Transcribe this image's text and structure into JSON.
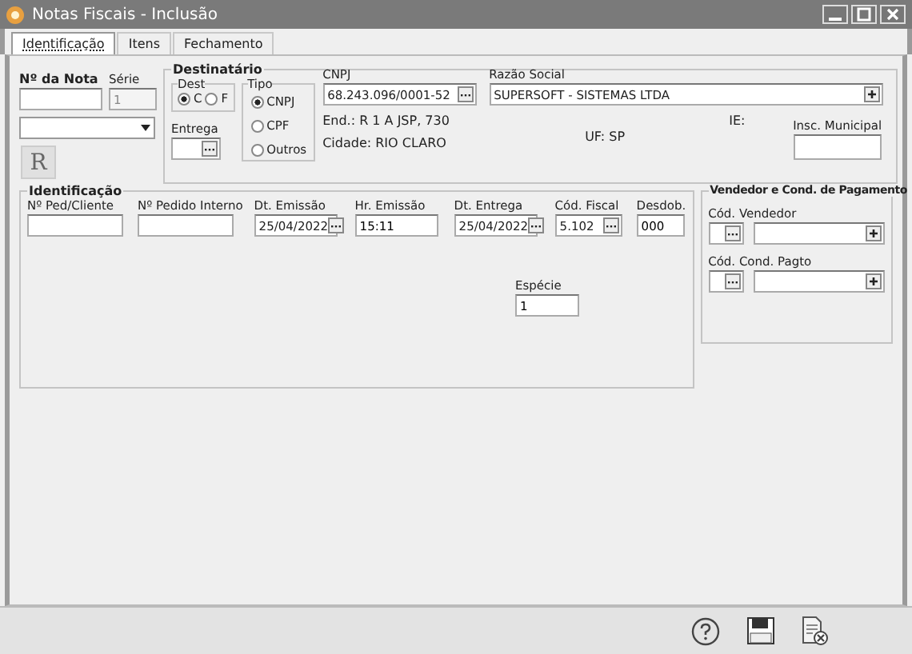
{
  "window": {
    "title": "Notas Fiscais - Inclusão"
  },
  "tabs": [
    {
      "label": "Identificação",
      "selected": true
    },
    {
      "label": "Itens",
      "selected": false
    },
    {
      "label": "Fechamento",
      "selected": false
    }
  ],
  "nota": {
    "label": "Nº da Nota",
    "serie_label": "Série",
    "serie_value": "1",
    "r_button": "R"
  },
  "destinatario": {
    "title": "Destinatário",
    "dest": {
      "title": "Dest",
      "options": [
        {
          "label": "C",
          "selected": true
        },
        {
          "label": "F",
          "selected": false
        }
      ]
    },
    "entrega_label": "Entrega",
    "tipo": {
      "title": "Tipo",
      "options": [
        {
          "label": "CNPJ",
          "selected": true
        },
        {
          "label": "CPF",
          "selected": false
        },
        {
          "label": "Outros",
          "selected": false
        }
      ]
    },
    "cnpj": {
      "label": "CNPJ",
      "value": "68.243.096/0001-52"
    },
    "endereco": "End.: R 1 A JSP, 730",
    "cidade": "Cidade: RIO CLARO",
    "razao": {
      "label": "Razão Social",
      "value": "SUPERSOFT - SISTEMAS LTDA"
    },
    "ie": "IE:",
    "uf": "UF: SP",
    "insc_label": "Insc. Municipal"
  },
  "identificacao": {
    "title": "Identificação",
    "fields": [
      {
        "label": "Nº Ped/Cliente",
        "kind": "text"
      },
      {
        "label": "Nº Pedido Interno",
        "kind": "text"
      },
      {
        "label": "Dt. Emissão",
        "value": "25/04/2022",
        "kind": "picker"
      },
      {
        "label": "Hr. Emissão",
        "value": "15:11",
        "kind": "text"
      },
      {
        "label": "Dt. Entrega",
        "value": "25/04/2022",
        "kind": "picker"
      },
      {
        "label": "Cód. Fiscal",
        "value": "5.102",
        "kind": "picker"
      },
      {
        "label": "Desdob.",
        "value": "000",
        "kind": "text"
      }
    ],
    "especie": {
      "label": "Espécie",
      "value": "1"
    }
  },
  "vendedor": {
    "title": "Vendedor e Cond. de Pagamento",
    "fields": [
      {
        "label": "Cód. Vendedor"
      },
      {
        "label": "Cód. Cond. Pagto"
      }
    ]
  },
  "toolbar": [
    {
      "kind": "help"
    },
    {
      "kind": "save"
    },
    {
      "kind": "cancel"
    }
  ]
}
